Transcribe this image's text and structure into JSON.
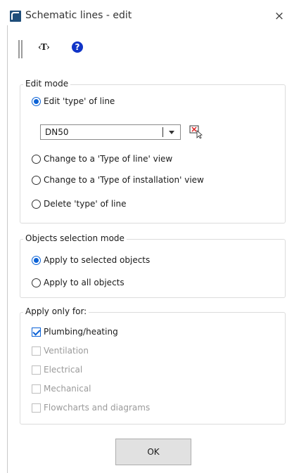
{
  "window": {
    "title": "Schematic lines - edit",
    "close_glyph": "×"
  },
  "toolbar": {
    "text_tool_label": "‹T›",
    "help_label": "?"
  },
  "edit_mode": {
    "legend": "Edit mode",
    "options": [
      {
        "label": "Edit 'type' of line",
        "selected": true
      },
      {
        "label": "Change to a 'Type of line' view",
        "selected": false
      },
      {
        "label": "Change to a 'Type of installation' view",
        "selected": false
      },
      {
        "label": "Delete 'type' of line",
        "selected": false
      }
    ],
    "line_type_value": "DN50"
  },
  "selection_mode": {
    "legend": "Objects selection mode",
    "options": [
      {
        "label": "Apply to selected objects",
        "selected": true
      },
      {
        "label": "Apply to all objects",
        "selected": false
      }
    ]
  },
  "apply_only": {
    "legend": "Apply only for:",
    "items": [
      {
        "label": "Plumbing/heating",
        "checked": true,
        "enabled": true
      },
      {
        "label": "Ventilation",
        "checked": false,
        "enabled": false
      },
      {
        "label": "Electrical",
        "checked": false,
        "enabled": false
      },
      {
        "label": "Mechanical",
        "checked": false,
        "enabled": false
      },
      {
        "label": "Flowcharts and diagrams",
        "checked": false,
        "enabled": false
      }
    ]
  },
  "buttons": {
    "ok_label": "OK"
  },
  "colors": {
    "accent": "#0b62d6",
    "app_icon": "#1f4e7a",
    "help": "#1034c7"
  }
}
